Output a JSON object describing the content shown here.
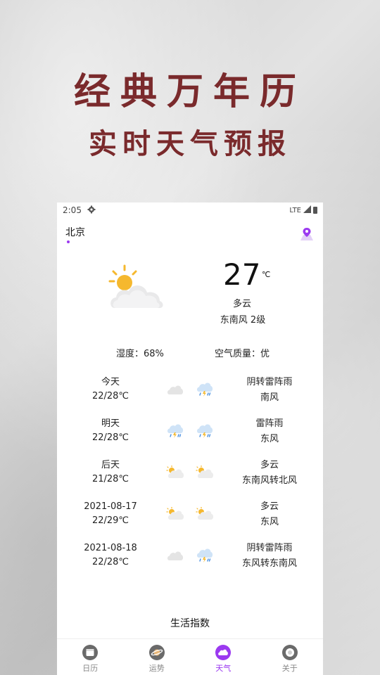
{
  "promo": {
    "line1": "经典万年历",
    "line2": "实时天气预报"
  },
  "status_bar": {
    "time": "2:05",
    "network": "LTE"
  },
  "location": {
    "city": "北京"
  },
  "current": {
    "temperature": "27",
    "unit": "℃",
    "condition": "多云",
    "wind": "东南风 2级",
    "humidity": "湿度：68%",
    "air_quality": "空气质量：优"
  },
  "forecast": [
    {
      "date": "今天",
      "temp": "22/28℃",
      "weather": "阴转雷阵雨",
      "wind": "南风",
      "icons": [
        "cloud-icon",
        "thunder-rain-icon"
      ]
    },
    {
      "date": "明天",
      "temp": "22/28℃",
      "weather": "雷阵雨",
      "wind": "东风",
      "icons": [
        "thunder-rain-icon",
        "thunder-rain-icon"
      ]
    },
    {
      "date": "后天",
      "temp": "21/28℃",
      "weather": "多云",
      "wind": "东南风转北风",
      "icons": [
        "partly-cloudy-icon",
        "partly-cloudy-icon"
      ]
    },
    {
      "date": "2021-08-17",
      "temp": "22/29℃",
      "weather": "多云",
      "wind": "东风",
      "icons": [
        "partly-cloudy-icon",
        "partly-cloudy-icon"
      ]
    },
    {
      "date": "2021-08-18",
      "temp": "22/28℃",
      "weather": "阴转雷阵雨",
      "wind": "东风转东南风",
      "icons": [
        "cloud-icon",
        "thunder-rain-icon"
      ]
    }
  ],
  "life_index": {
    "title": "生活指数"
  },
  "tabs": [
    {
      "label": "日历",
      "active": false,
      "color": "#6a6a6a"
    },
    {
      "label": "运势",
      "active": false,
      "color": "#6a6a6a"
    },
    {
      "label": "天气",
      "active": true,
      "color": "#9b39f0"
    },
    {
      "label": "关于",
      "active": false,
      "color": "#6a6a6a"
    }
  ],
  "colors": {
    "accent": "#9b39f0",
    "promo": "#7a2a2c"
  }
}
